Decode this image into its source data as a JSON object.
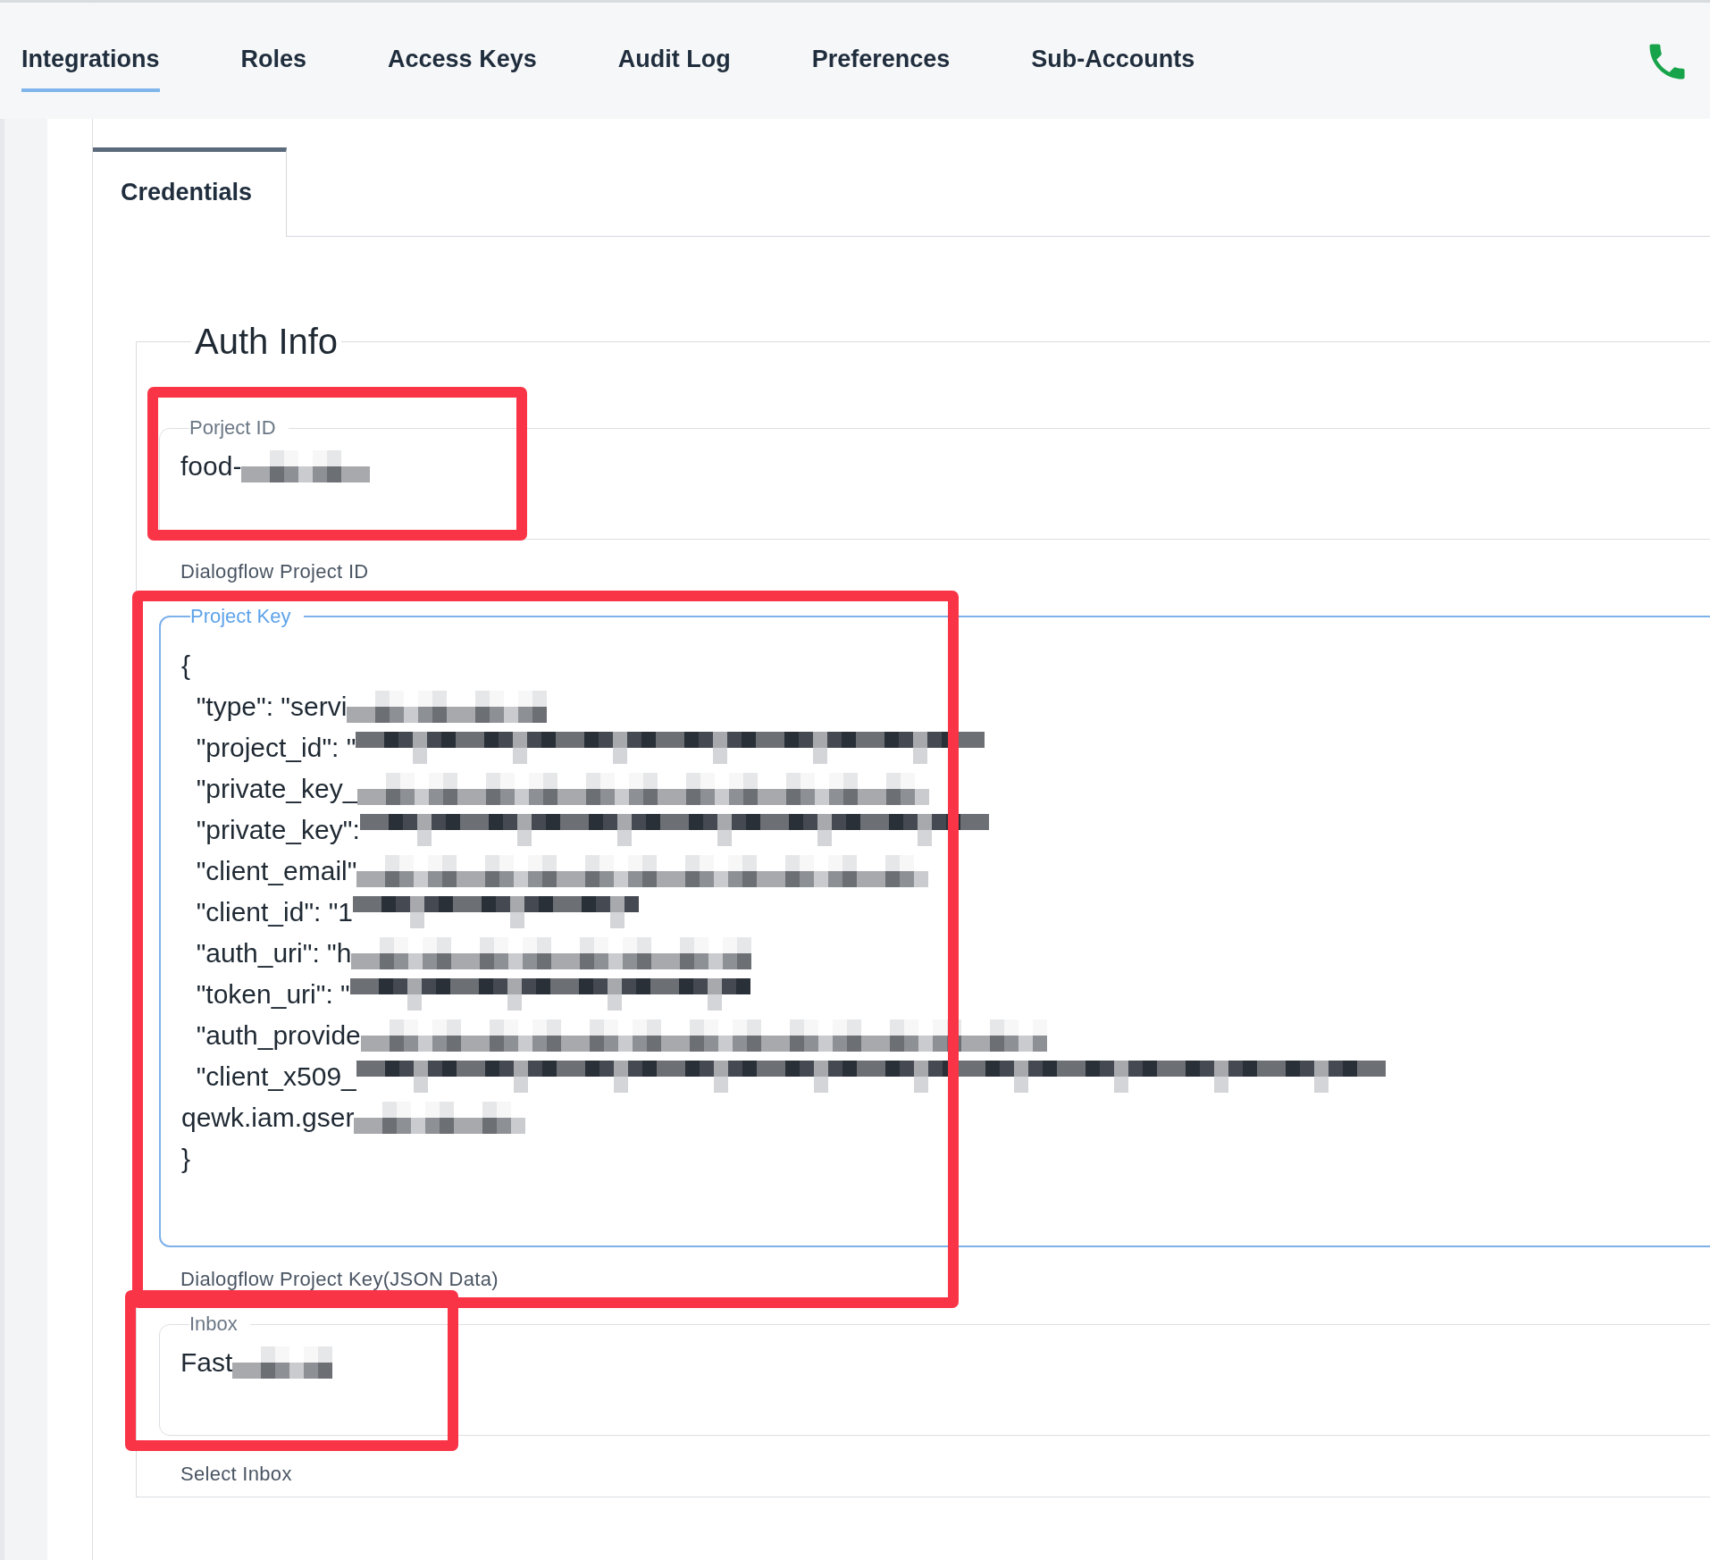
{
  "nav": {
    "tabs": [
      {
        "label": "Integrations",
        "selected": true
      },
      {
        "label": "Roles",
        "selected": false
      },
      {
        "label": "Access Keys",
        "selected": false
      },
      {
        "label": "Audit Log",
        "selected": false
      },
      {
        "label": "Preferences",
        "selected": false
      },
      {
        "label": "Sub-Accounts",
        "selected": false
      }
    ]
  },
  "subtabs": [
    {
      "label": "Credentials",
      "selected": true
    }
  ],
  "section": {
    "title": "Auth Info",
    "fields": [
      {
        "kind": "input",
        "label": "Porject ID",
        "focused": false,
        "highlighted": true,
        "hint": "Dialogflow Project ID",
        "lines": [
          {
            "text": "food-",
            "redacted": true
          }
        ]
      },
      {
        "kind": "textarea",
        "label": "Project Key",
        "focused": true,
        "highlighted": true,
        "hint": "Dialogflow Project Key(JSON Data)",
        "lines": [
          {
            "text": "{",
            "redacted": false
          },
          {
            "text": "  \"type\": \"servi",
            "redacted": true
          },
          {
            "text": "  \"project_id\": \"",
            "redacted": true
          },
          {
            "text": "  \"private_key_",
            "redacted": true
          },
          {
            "text": "  \"private_key\":",
            "redacted": true
          },
          {
            "text": "  \"client_email\"",
            "redacted": true
          },
          {
            "text": "  \"client_id\": \"1",
            "redacted": true
          },
          {
            "text": "  \"auth_uri\": \"h",
            "redacted": true
          },
          {
            "text": "  \"token_uri\": \"",
            "redacted": true
          },
          {
            "text": "  \"auth_provide",
            "redacted": true
          },
          {
            "text": "  \"client_x509_",
            "redacted": true
          },
          {
            "text": "qewk.iam.gser",
            "redacted": true
          },
          {
            "text": "}",
            "redacted": false
          }
        ]
      },
      {
        "kind": "select",
        "label": "Inbox",
        "focused": false,
        "highlighted": true,
        "hint": "Select Inbox",
        "lines": [
          {
            "text": "Fast",
            "redacted": true
          }
        ]
      }
    ]
  }
}
